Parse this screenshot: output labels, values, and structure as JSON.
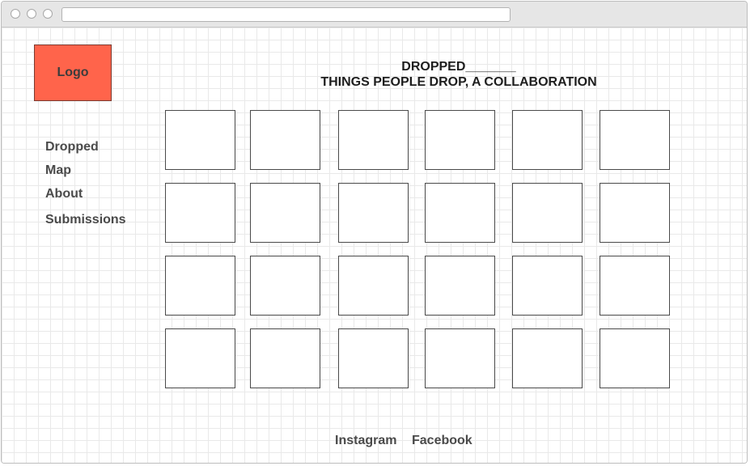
{
  "browser": {
    "url": ""
  },
  "logo": {
    "label": "Logo"
  },
  "header": {
    "title_line1": "DROPPED_______",
    "title_line2": "THINGS PEOPLE DROP, A COLLABORATION"
  },
  "nav": {
    "items": [
      {
        "label": "Dropped"
      },
      {
        "label": "Map"
      },
      {
        "label": "About"
      },
      {
        "label": "Submissions"
      }
    ]
  },
  "gallery": {
    "rows": 4,
    "columns": 6
  },
  "footer": {
    "links": [
      {
        "label": "Instagram"
      },
      {
        "label": "Facebook"
      }
    ]
  }
}
